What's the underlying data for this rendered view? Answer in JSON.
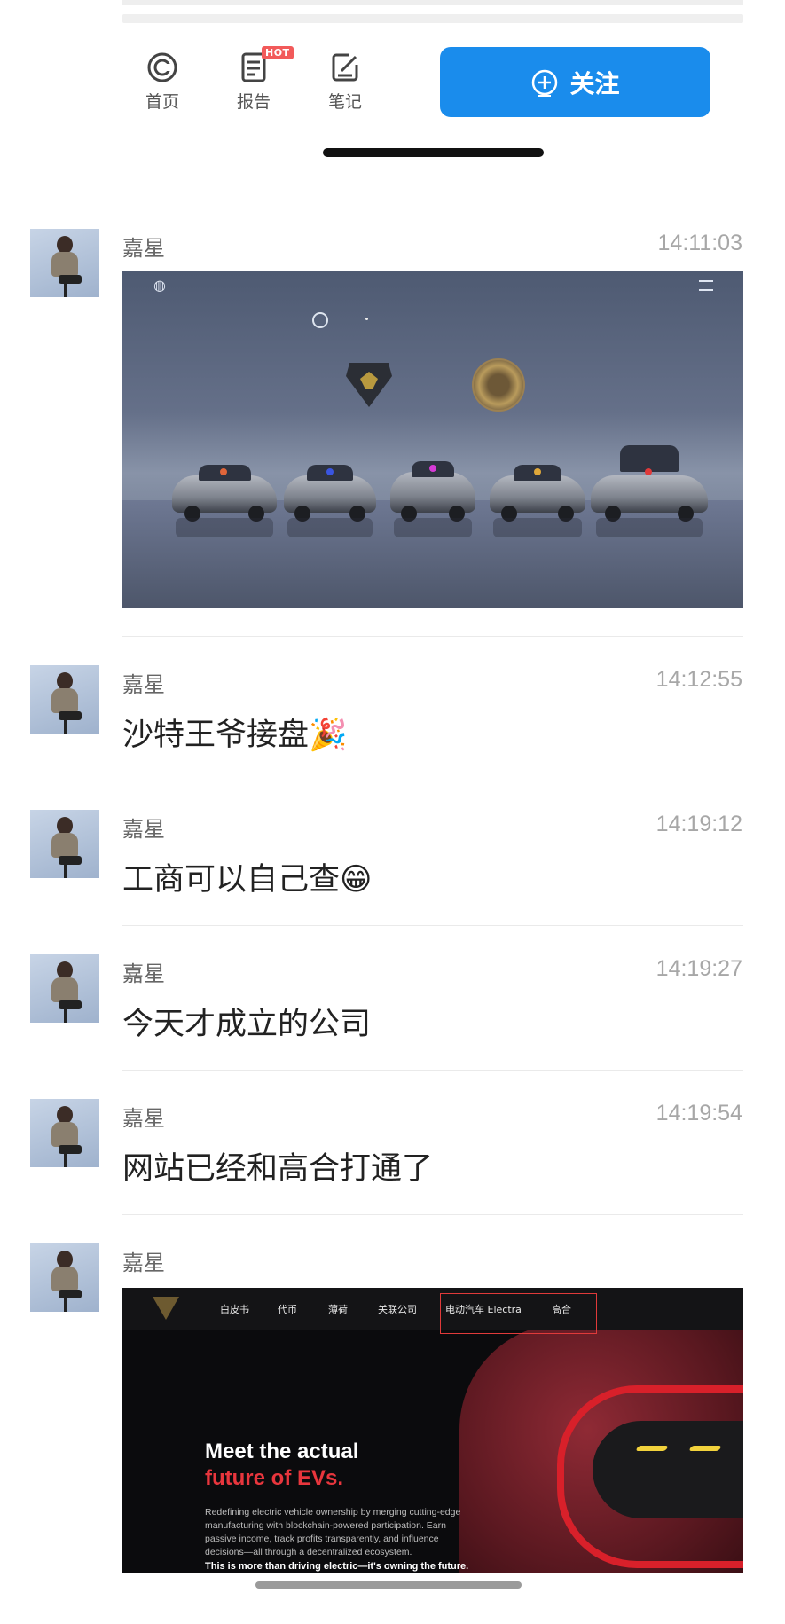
{
  "toolbar": {
    "home_label": "首页",
    "report_label": "报告",
    "report_badge": "HOT",
    "notes_label": "笔记",
    "follow_label": "关注"
  },
  "messages": [
    {
      "name": "嘉星",
      "time": "14:11:03",
      "type": "image"
    },
    {
      "name": "嘉星",
      "time": "14:12:55",
      "text": "沙特王爷接盘🎉"
    },
    {
      "name": "嘉星",
      "time": "14:19:12",
      "text": "工商可以自己查😁"
    },
    {
      "name": "嘉星",
      "time": "14:19:27",
      "text": "今天才成立的公司"
    },
    {
      "name": "嘉星",
      "time": "14:19:54",
      "text": "网站已经和高合打通了"
    },
    {
      "name": "嘉星",
      "type": "image"
    }
  ],
  "screenshot2": {
    "nav": [
      "白皮书",
      "代币",
      "薄荷",
      "关联公司",
      "电动汽车 Electra",
      "高合"
    ],
    "headline_white": "Meet the actual",
    "headline_red": "future of EVs.",
    "paragraph": "Redefining electric vehicle ownership by merging cutting-edge manufacturing with blockchain-powered participation. Earn passive income, track profits transparently, and influence decisions—all through a decentralized ecosystem.",
    "tagline": "This is more than driving electric—it's owning the future."
  },
  "colors": {
    "accent": "#1a8cec",
    "hot_badge": "#f25a5a",
    "highlight": "#e8363d"
  }
}
